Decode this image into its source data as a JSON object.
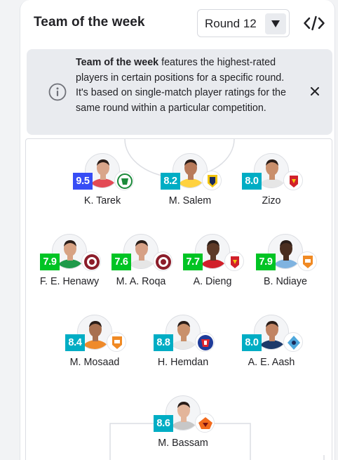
{
  "header": {
    "title": "Team of the week",
    "round_select": {
      "value": "Round 12"
    }
  },
  "info": {
    "title": "Team of the week",
    "body": " features the highest-rated players in certain positions for a specific round. It's based on single-match player ratings for the same round within a particular competition."
  },
  "colors": {
    "rating_blue": "#374df5",
    "rating_teal": "#00adc4",
    "rating_green": "#00c424"
  },
  "players": [
    {
      "name": "K. Tarek",
      "rating": "9.5",
      "badge_color": "#374df5",
      "crest": "green-white-crest-icon"
    },
    {
      "name": "M. Salem",
      "rating": "8.2",
      "badge_color": "#00adc4",
      "crest": "yellow-navy-crest-icon"
    },
    {
      "name": "Zizo",
      "rating": "8.0",
      "badge_color": "#00adc4",
      "crest": "red-eagle-crest-icon"
    },
    {
      "name": "F. E. Henawy",
      "rating": "7.9",
      "badge_color": "#00c424",
      "crest": "maroon-circle-crest-icon"
    },
    {
      "name": "M. A. Roqa",
      "rating": "7.6",
      "badge_color": "#00c424",
      "crest": "maroon-circle-crest-icon"
    },
    {
      "name": "A. Dieng",
      "rating": "7.7",
      "badge_color": "#00c424",
      "crest": "red-eagle-crest-icon"
    },
    {
      "name": "B. Ndiaye",
      "rating": "7.9",
      "badge_color": "#00c424",
      "crest": "orange-shield-crest-icon"
    },
    {
      "name": "M. Mosaad",
      "rating": "8.4",
      "badge_color": "#00adc4",
      "crest": "orange-shield-crest-icon"
    },
    {
      "name": "H. Hemdan",
      "rating": "8.8",
      "badge_color": "#00adc4",
      "crest": "red-blue-crest-icon"
    },
    {
      "name": "A. E. Aash",
      "rating": "8.0",
      "badge_color": "#00adc4",
      "crest": "skyblue-diamond-crest-icon"
    },
    {
      "name": "M. Bassam",
      "rating": "8.6",
      "badge_color": "#00adc4",
      "crest": "orange-bird-crest-icon"
    }
  ]
}
